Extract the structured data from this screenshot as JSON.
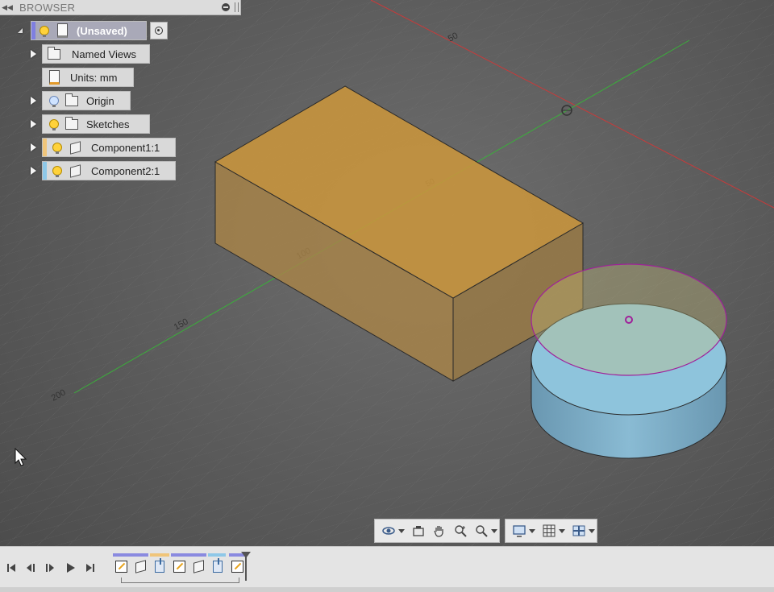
{
  "browser": {
    "title": "BROWSER",
    "root": {
      "label": "(Unsaved)"
    },
    "items": [
      {
        "label": "Named Views"
      },
      {
        "label": "Units: mm"
      },
      {
        "label": "Origin"
      },
      {
        "label": "Sketches"
      },
      {
        "label": "Component1:1",
        "color": "#f0c57a"
      },
      {
        "label": "Component2:1",
        "color": "#8ec8e8"
      }
    ]
  },
  "viewport": {
    "axis_labels": [
      "50",
      "50",
      "100",
      "150",
      "200"
    ],
    "colors": {
      "box_top": "#c9953c",
      "box_front": "#a88448",
      "box_side": "#9a7a44",
      "cylinder": "#7aafc9",
      "sketch": "#a0209a",
      "x_axis": "#c83a3a",
      "y_axis": "#3ab03a"
    }
  },
  "navbar": {
    "group1": [
      "orbit-icon",
      "look-at-icon",
      "pan-icon",
      "zoom-icon",
      "zoom-window-icon"
    ],
    "group2": [
      "display-settings-icon",
      "grid-icon",
      "viewports-icon"
    ]
  },
  "timeline": {
    "controls": [
      "go-to-start",
      "step-back",
      "play-back",
      "play",
      "go-to-end"
    ],
    "features": [
      "sketch",
      "box",
      "extrude",
      "sketch",
      "box",
      "extrude",
      "sketch"
    ]
  }
}
